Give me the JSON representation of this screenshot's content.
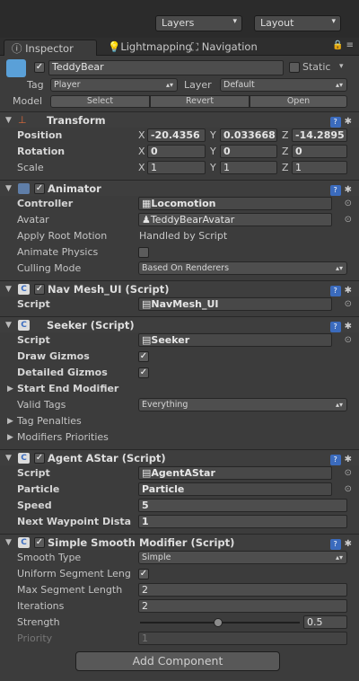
{
  "toolbar": {
    "layers": "Layers",
    "layout": "Layout"
  },
  "tabs": {
    "inspector": "Inspector",
    "lightmapping": "Lightmapping",
    "navigation": "Navigation"
  },
  "object": {
    "name": "TeddyBear",
    "static_label": "Static",
    "tag_label": "Tag",
    "tag_value": "Player",
    "layer_label": "Layer",
    "layer_value": "Default",
    "model_label": "Model",
    "select": "Select",
    "revert": "Revert",
    "open": "Open"
  },
  "transform": {
    "title": "Transform",
    "position_label": "Position",
    "rotation_label": "Rotation",
    "scale_label": "Scale",
    "pos": [
      "-20.4356",
      "0.033668",
      "-14.2895"
    ],
    "rot": [
      "0",
      "0",
      "0"
    ],
    "scale": [
      "1",
      "1",
      "1"
    ],
    "x": "X",
    "y": "Y",
    "z": "Z"
  },
  "animator": {
    "title": "Animator",
    "controller_label": "Controller",
    "controller_value": "Locomotion",
    "avatar_label": "Avatar",
    "avatar_value": "TeddyBearAvatar",
    "root_motion_label": "Apply Root Motion",
    "root_motion_value": "Handled by Script",
    "physics_label": "Animate Physics",
    "culling_label": "Culling Mode",
    "culling_value": "Based On Renderers"
  },
  "navmesh": {
    "title": "Nav Mesh_UI (Script)",
    "script_label": "Script",
    "script_value": "NavMesh_UI"
  },
  "seeker": {
    "title": "Seeker (Script)",
    "script_label": "Script",
    "script_value": "Seeker",
    "draw_gizmos_label": "Draw Gizmos",
    "detailed_gizmos_label": "Detailed Gizmos",
    "start_end_label": "Start End Modifier",
    "valid_tags_label": "Valid Tags",
    "valid_tags_value": "Everything",
    "tag_penalties_label": "Tag Penalties",
    "modifiers_label": "Modifiers Priorities"
  },
  "agent": {
    "title": "Agent AStar (Script)",
    "script_label": "Script",
    "script_value": "AgentAStar",
    "particle_label": "Particle",
    "particle_value": "Particle",
    "speed_label": "Speed",
    "speed_value": "5",
    "waypoint_label": "Next Waypoint Dista",
    "waypoint_value": "1"
  },
  "smooth": {
    "title": "Simple Smooth Modifier (Script)",
    "type_label": "Smooth Type",
    "type_value": "Simple",
    "uniform_label": "Uniform Segment Leng",
    "max_seg_label": "Max Segment Length",
    "max_seg_value": "2",
    "iterations_label": "Iterations",
    "iterations_value": "2",
    "strength_label": "Strength",
    "strength_value": "0.5",
    "priority_label": "Priority",
    "priority_value": "1"
  },
  "add_component": "Add Component"
}
